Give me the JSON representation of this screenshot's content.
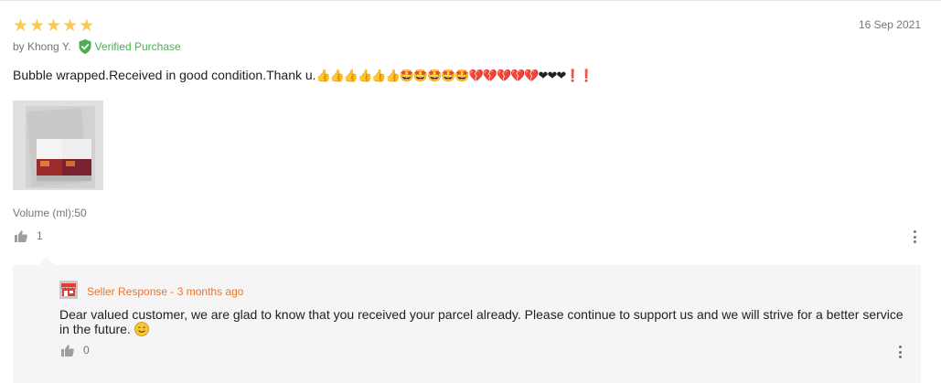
{
  "review": {
    "rating": 5,
    "rating_max": 5,
    "star_glyph": "★",
    "author": "by Khong Y.",
    "verified_label": "Verified Purchase",
    "date": "16 Sep 2021",
    "text": "Bubble wrapped.Received in good condition.Thank u.",
    "emojis": "👍👍👍👍👍👍🤩🤩🤩🤩🤩💔💔💔💔💔❤❤❤❗❗",
    "image_alt_icon": "product-photo",
    "variant": "Volume (ml):50",
    "likes": "1"
  },
  "seller_response": {
    "title": "Seller Response - 3 months ago",
    "text": "Dear valued customer, we are glad to know that you received your parcel already. Please continue to support us and we will strive for a better service in the future.",
    "likes": "0"
  },
  "colors": {
    "star": "#faca51",
    "verified": "#4caf50",
    "seller_title": "#f57224",
    "response_bg": "#f5f5f5",
    "muted_text": "#757575"
  }
}
